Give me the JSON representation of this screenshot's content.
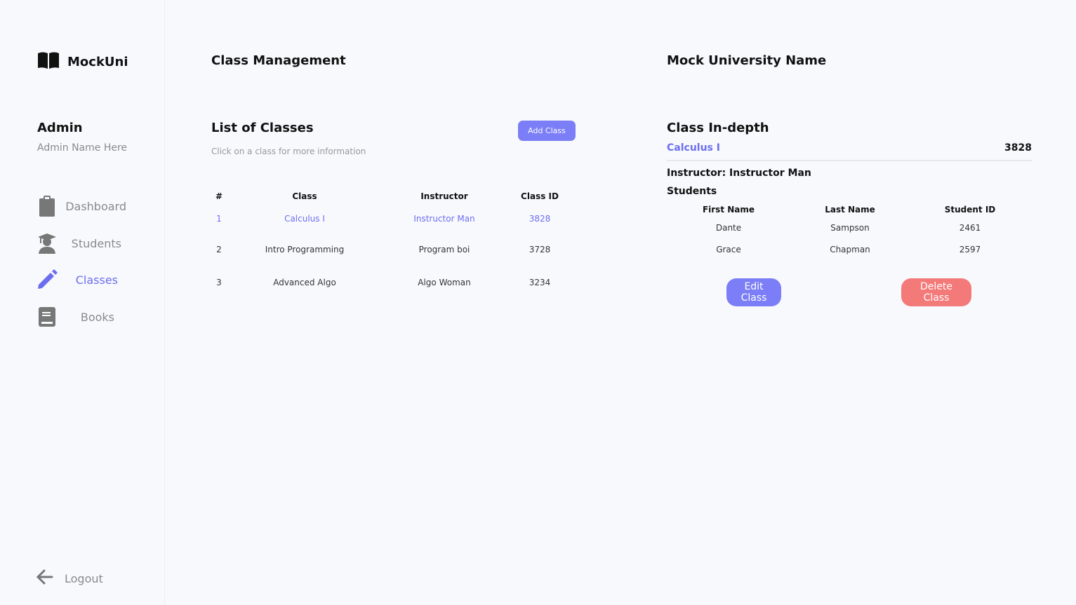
{
  "app": {
    "name": "MockUni"
  },
  "user": {
    "role": "Admin",
    "name": "Admin Name Here"
  },
  "nav": {
    "items": [
      {
        "label": "Dashboard",
        "icon": "clipboard-icon"
      },
      {
        "label": "Students",
        "icon": "graduate-icon"
      },
      {
        "label": "Classes",
        "icon": "pencil-icon",
        "active": true
      },
      {
        "label": "Books",
        "icon": "book-icon"
      }
    ],
    "logout": "Logout"
  },
  "colors": {
    "accent": "#6c6ef0",
    "button": "#7b7ef6",
    "danger": "#f47a7a"
  },
  "middle": {
    "page_title": "Class Management",
    "list_title": "List of Classes",
    "hint": "Click on a class for more information",
    "add_button": "Add Class",
    "columns": [
      "#",
      "Class",
      "Instructor",
      "Class ID"
    ],
    "rows": [
      {
        "num": "1",
        "class": "Calculus I",
        "instructor": "Instructor Man",
        "id": "3828"
      },
      {
        "num": "2",
        "class": "Intro Programming",
        "instructor": "Program boi",
        "id": "3728"
      },
      {
        "num": "3",
        "class": "Advanced Algo",
        "instructor": "Algo Woman",
        "id": "3234"
      }
    ]
  },
  "right": {
    "page_title": "Mock University Name",
    "detail_title": "Class In-depth",
    "class_name": "Calculus I",
    "class_id": "3828",
    "instructor_line": "Instructor: Instructor Man",
    "students_title": "Students",
    "student_columns": [
      "First Name",
      "Last Name",
      "Student ID"
    ],
    "students": [
      {
        "first": "Dante",
        "last": "Sampson",
        "id": "2461"
      },
      {
        "first": "Grace",
        "last": "Chapman",
        "id": "2597"
      }
    ],
    "edit_button_line1": "Edit",
    "edit_button_line2": "Class",
    "delete_button_line1": "Delete",
    "delete_button_line2": "Class"
  }
}
